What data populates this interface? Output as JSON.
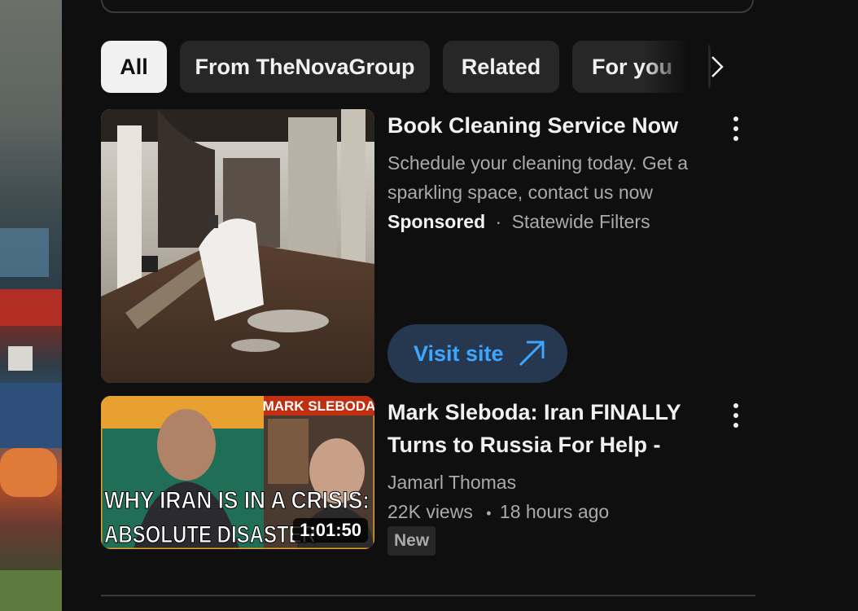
{
  "chips": [
    {
      "label": "All",
      "active": true
    },
    {
      "label": "From TheNovaGroup",
      "active": false
    },
    {
      "label": "Related",
      "active": false
    },
    {
      "label": "For you",
      "active": false
    }
  ],
  "ad": {
    "title": "Book Cleaning Service Now",
    "description": "Schedule your cleaning today. Get a sparkling space, contact us now",
    "sponsored_label": "Sponsored",
    "separator": "·",
    "advertiser": "Statewide Filters",
    "cta_label": "Visit site"
  },
  "video": {
    "title": "Mark Sleboda: Iran FINALLY Turns to Russia For Help - Maj...",
    "channel": "Jamarl Thomas",
    "views": "22K views",
    "separator": "•",
    "age": "18 hours ago",
    "badge": "New",
    "duration": "1:01:50",
    "thumb_text_top": "WHY IRAN IS IN A CRISIS:",
    "thumb_text_bottom": "ABSOLUTE DISASTER",
    "thumb_name_tag": "MARK SLEBODA"
  },
  "colors": {
    "background": "#0f0f0f",
    "chip_bg": "#272727",
    "chip_active_bg": "#f1f1f1",
    "link_blue": "#3ea6ff",
    "cta_bg": "#263850",
    "secondary_text": "#aaaaaa"
  },
  "icons": {
    "chip_next": "chevron-right-icon",
    "more": "more-vert-icon",
    "external": "arrow-up-right-icon"
  }
}
